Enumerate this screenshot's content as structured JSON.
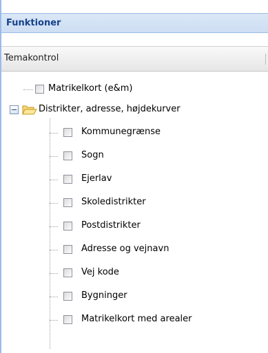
{
  "panel": {
    "title": "Funktioner"
  },
  "section": {
    "title": "Temakontrol"
  },
  "tree": {
    "root_item": {
      "label": "Matrikelkort (e&m)",
      "checked": false
    },
    "folder": {
      "label": "Distrikter, adresse, højdekurver",
      "expanded": true,
      "icon": "folder-open-icon",
      "children": [
        {
          "label": "Kommunegrænse",
          "checked": false
        },
        {
          "label": "Sogn",
          "checked": false
        },
        {
          "label": "Ejerlav",
          "checked": false
        },
        {
          "label": "Skoledistrikter",
          "checked": false
        },
        {
          "label": "Postdistrikter",
          "checked": false
        },
        {
          "label": "Adresse og vejnavn",
          "checked": false
        },
        {
          "label": "Vej kode",
          "checked": false
        },
        {
          "label": "Bygninger",
          "checked": false
        },
        {
          "label": "Matrikelkort med arealer",
          "checked": false
        }
      ]
    }
  },
  "colors": {
    "header_text": "#15428b",
    "header_bg": "#dae7f6",
    "border": "#99bbe8",
    "folder": "#f5c542"
  }
}
